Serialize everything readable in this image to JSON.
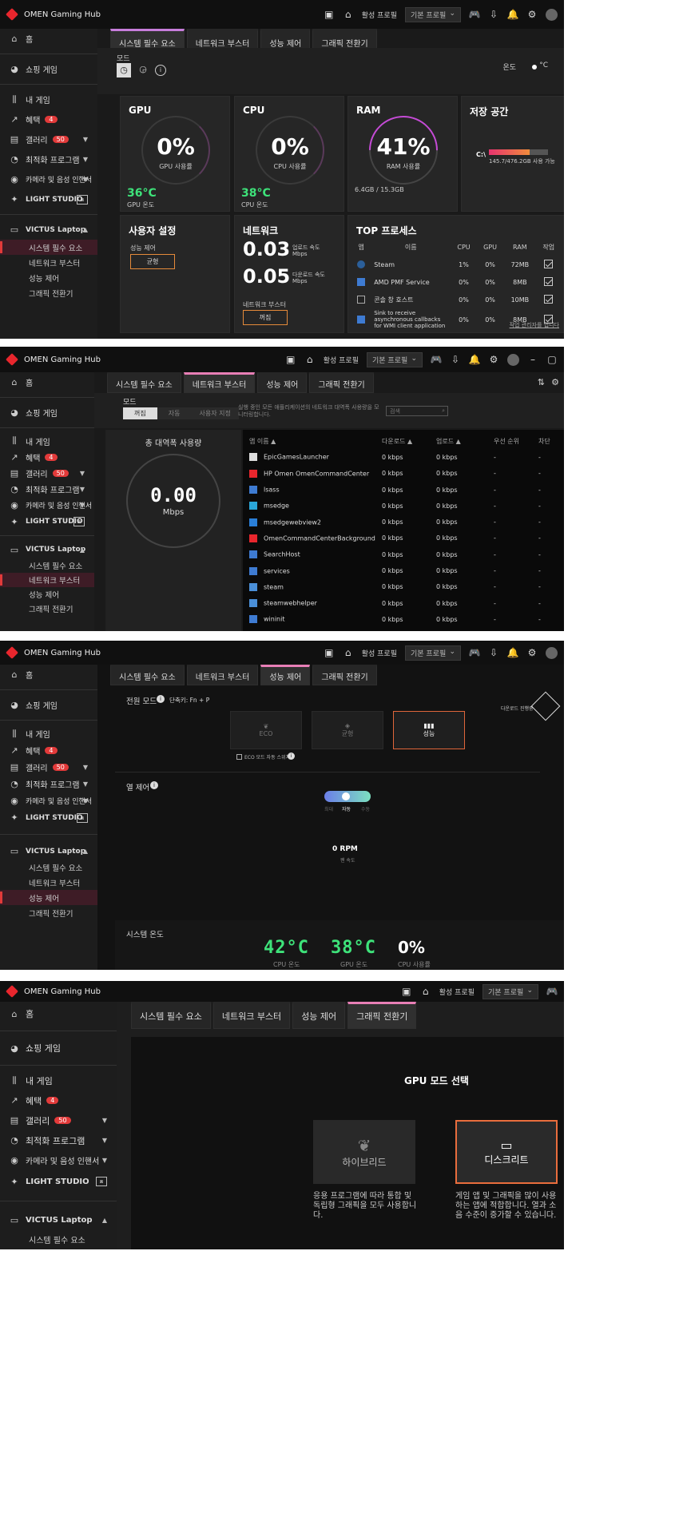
{
  "app": {
    "title": "OMEN Gaming Hub",
    "profile_label": "활성 프로필",
    "profile_value": "기본 프로필"
  },
  "sidebar": {
    "home": "홈",
    "shop": "쇼핑 게임",
    "my_games": "내 게임",
    "benefits": "혜택",
    "benefits_badge": "4",
    "gallery": "갤러리",
    "gallery_badge": "50",
    "optimizer": "최적화 프로그램",
    "camera": "카메라 및 음성 인핸서",
    "light_studio": "LIGHT STUDIO",
    "device": "VICTUS Laptop",
    "sub": [
      "시스템 필수 요소",
      "네트워크 부스터",
      "성능 제어",
      "그래픽 전환기"
    ]
  },
  "tabs": [
    "시스템 필수 요소",
    "네트워크 부스터",
    "성능 제어",
    "그래픽 전환기"
  ],
  "p1": {
    "mode": "모드",
    "temp_label": "온도",
    "temp_unit": "°C",
    "gpu": {
      "title": "GPU",
      "value": "0%",
      "label": "GPU 사용률",
      "temp": "36°C",
      "temp_label": "GPU 온도"
    },
    "cpu": {
      "title": "CPU",
      "value": "0%",
      "label": "CPU 사용률",
      "temp": "38°C",
      "temp_label": "CPU 온도"
    },
    "ram": {
      "title": "RAM",
      "value": "41%",
      "label": "RAM 사용률",
      "detail": "6.4GB / 15.3GB",
      "fill": 0.41
    },
    "storage": {
      "title": "저장 공간",
      "drive": "C:\\",
      "detail": "145.7/476.2GB 사용 가능",
      "fill": 0.69
    },
    "user": {
      "title": "사용자 설정",
      "perf": "성능 제어",
      "btn": "균형"
    },
    "net": {
      "title": "네트워크",
      "up": "0.03",
      "up_label": "업로드 속도",
      "up_unit": "Mbps",
      "down": "0.05",
      "down_label": "다운로드 속도",
      "down_unit": "Mbps",
      "booster": "네트워크 부스터",
      "btn": "꺼짐"
    },
    "top": {
      "title": "TOP 프로세스",
      "headers": [
        "앱",
        "이름",
        "CPU",
        "GPU",
        "RAM",
        "작업"
      ],
      "rows": [
        {
          "name": "Steam",
          "cpu": "1%",
          "gpu": "0%",
          "ram": "72MB",
          "icon": "steam-icon"
        },
        {
          "name": "AMD PMF Service",
          "cpu": "0%",
          "gpu": "0%",
          "ram": "8MB",
          "icon": "app-icon"
        },
        {
          "name": "콘솔 창 호스트",
          "cpu": "0%",
          "gpu": "0%",
          "ram": "10MB",
          "icon": "console-icon"
        },
        {
          "name": "Sink to receive asynchronous callbacks for WMI client application",
          "cpu": "0%",
          "gpu": "0%",
          "ram": "8MB",
          "icon": "app-icon"
        }
      ],
      "link": "작업 관리자를 엽니다"
    }
  },
  "p2": {
    "mode": "모드",
    "modes": [
      "꺼짐",
      "자동",
      "사용자 지정"
    ],
    "desc": "실행 중인 모든 애플리케이션의 네트워크 대역폭 사용량을 모니터링합니다.",
    "search_placeholder": "검색",
    "bw_title": "총 대역폭 사용량",
    "bw_value": "0.00",
    "bw_unit": "Mbps",
    "headers": [
      "앱 이름",
      "다운로드",
      "업로드",
      "우선 순위",
      "차단"
    ],
    "rows": [
      {
        "name": "EpicGamesLauncher",
        "down": "0 kbps",
        "up": "0 kbps",
        "pri": "-",
        "blk": "-"
      },
      {
        "name": "HP Omen OmenCommandCenter",
        "down": "0 kbps",
        "up": "0 kbps",
        "pri": "-",
        "blk": "-"
      },
      {
        "name": "lsass",
        "down": "0 kbps",
        "up": "0 kbps",
        "pri": "-",
        "blk": "-"
      },
      {
        "name": "msedge",
        "down": "0 kbps",
        "up": "0 kbps",
        "pri": "-",
        "blk": "-"
      },
      {
        "name": "msedgewebview2",
        "down": "0 kbps",
        "up": "0 kbps",
        "pri": "-",
        "blk": "-"
      },
      {
        "name": "OmenCommandCenterBackground",
        "down": "0 kbps",
        "up": "0 kbps",
        "pri": "-",
        "blk": "-"
      },
      {
        "name": "SearchHost",
        "down": "0 kbps",
        "up": "0 kbps",
        "pri": "-",
        "blk": "-"
      },
      {
        "name": "services",
        "down": "0 kbps",
        "up": "0 kbps",
        "pri": "-",
        "blk": "-"
      },
      {
        "name": "steam",
        "down": "0 kbps",
        "up": "0 kbps",
        "pri": "-",
        "blk": "-"
      },
      {
        "name": "steamwebhelper",
        "down": "0 kbps",
        "up": "0 kbps",
        "pri": "-",
        "blk": "-"
      },
      {
        "name": "wininit",
        "down": "0 kbps",
        "up": "0 kbps",
        "pri": "-",
        "blk": "-"
      }
    ]
  },
  "p3": {
    "power_mode": "전원 모드",
    "shortcut": "단축키: Fn + P",
    "omen_link": "다운로드 진행중",
    "modes": [
      "ECO",
      "균형",
      "성능"
    ],
    "eco_auto": "ECO 모드 자동 스위치",
    "fan": "열 제어",
    "fan_modes": [
      "최대",
      "자동",
      "수동"
    ],
    "rpm": "0 RPM",
    "rpm_label": "팬 속도",
    "sys_temp": "시스템 온도",
    "cpu_temp": "42°C",
    "cpu_temp_label": "CPU 온도",
    "gpu_temp": "38°C",
    "gpu_temp_label": "GPU 온도",
    "cpu_use": "0%",
    "cpu_use_label": "CPU 사용률"
  },
  "p4": {
    "title": "GPU 모드 선택",
    "hybrid": "하이브리드",
    "hybrid_desc": "응용 프로그램에 따라 통합 및 독립형 그래픽을 모두 사용합니다.",
    "discrete": "디스크리트",
    "discrete_desc": "게임 앱 및 그래픽을 많이 사용하는 앱에 적합합니다. 열과 소음 수준이 증가할 수 있습니다."
  }
}
